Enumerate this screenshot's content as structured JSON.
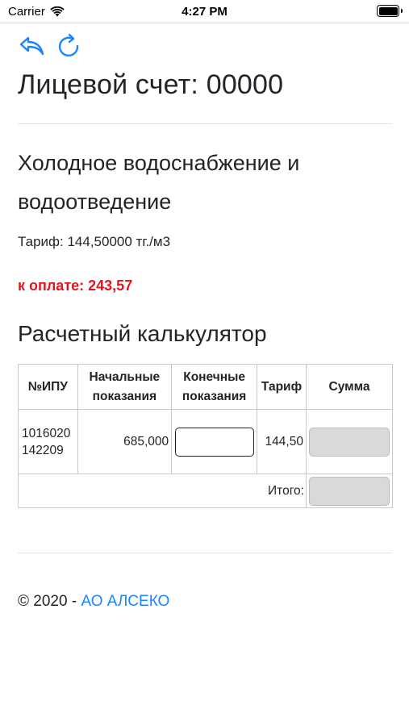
{
  "status_bar": {
    "carrier": "Carrier",
    "time": "4:27 PM"
  },
  "nav": {
    "back_icon": "reply-arrow-icon",
    "refresh_icon": "refresh-icon",
    "accent_color": "#1a85ff"
  },
  "page": {
    "title": "Лицевой счет: 00000"
  },
  "service": {
    "title": "Холодное водоснабжение и водоотведение",
    "tariff": "Тариф: 144,50000 тг./м3",
    "to_pay": "к оплате: 243,57",
    "to_pay_color": "#e8141b"
  },
  "calculator": {
    "title": "Расчетный калькулятор",
    "headers": {
      "ipu": "№ИПУ",
      "start": "Начальные показания",
      "end": "Конечные показания",
      "tariff": "Тариф",
      "sum": "Сумма"
    },
    "row": {
      "ipu": "1016020142209",
      "start": "685,000",
      "end_value": "",
      "tariff": "144,50",
      "sum_value": ""
    },
    "total_label": "Итого:",
    "total_value": ""
  },
  "footer": {
    "copyright": "© 2020 - ",
    "link": "АО АЛСЕКО"
  }
}
